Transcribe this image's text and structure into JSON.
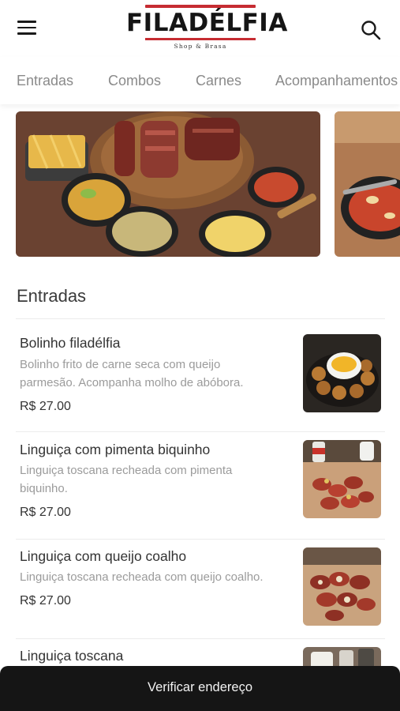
{
  "header": {
    "logo_text": "FILADÉLFIA",
    "logo_subtitle": "Shop & Brasa"
  },
  "categories": [
    "Entradas",
    "Combos",
    "Carnes",
    "Acompanhamentos"
  ],
  "section": {
    "title": "Entradas"
  },
  "items": [
    {
      "name": "Bolinho filadélfia",
      "description_lines": [
        "Bolinho frito de carne seca com queijo",
        "parmesão. Acompanha molho de abóbora."
      ],
      "price": "R$ 27.00"
    },
    {
      "name": "Linguiça com pimenta biquinho",
      "description_lines": [
        "Linguiça toscana recheada com pimenta",
        "biquinho."
      ],
      "price": "R$ 27.00"
    },
    {
      "name": "Linguiça com queijo coalho",
      "description_lines": [
        "Linguiça toscana recheada com queijo coalho."
      ],
      "price": "R$ 27.00"
    },
    {
      "name": "Linguiça toscana"
    }
  ],
  "bottom_bar": {
    "label": "Verificar endereço"
  },
  "colors": {
    "brand_red": "#c62c32",
    "bottom_bar": "#151515",
    "muted_text": "#9b9b9b"
  }
}
